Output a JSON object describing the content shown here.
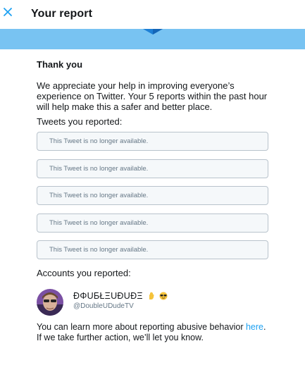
{
  "header": {
    "title": "Your report",
    "close_icon": "close-icon",
    "accent": "#1da1f2"
  },
  "banner": {
    "color": "#78c3f2"
  },
  "report": {
    "thanks": "Thank you",
    "appreciate": "We appreciate your help in improving everyone’s experience on Twitter. Your 5 reports within the past hour will help make this a safer and better place.",
    "tweets_label": "Tweets you reported:",
    "tweets": [
      "This Tweet is no longer available.",
      "This Tweet is no longer available.",
      "This Tweet is no longer available.",
      "This Tweet is no longer available.",
      "This Tweet is no longer available."
    ],
    "accounts_label": "Accounts you reported:",
    "account": {
      "name": "ÐΦUƂŁΞUÐUÐΞ",
      "handle": "@DoubleUDudeTV",
      "emojis": [
        "raised-hand-emoji",
        "sunglasses-emoji"
      ]
    },
    "learn_prefix": "You can learn more about reporting abusive behavior",
    "learn_link": "here",
    "learn_suffix": ". If we take further action, we’ll let you know."
  }
}
